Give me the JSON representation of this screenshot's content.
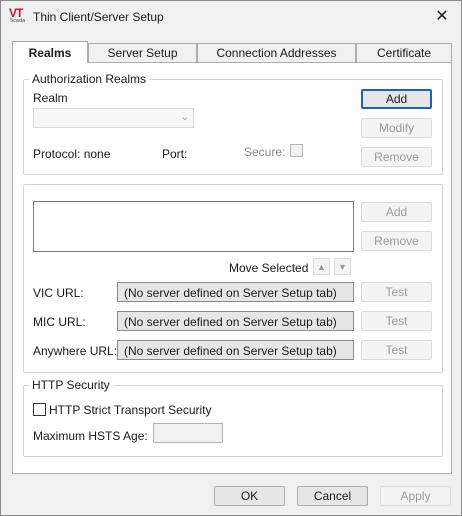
{
  "window": {
    "title": "Thin Client/Server Setup",
    "icon_text": "VT",
    "icon_subtext": "Scada",
    "close_glyph": "✕"
  },
  "tabs": [
    {
      "label": "Realms",
      "active": true
    },
    {
      "label": "Server Setup",
      "active": false
    },
    {
      "label": "Connection Addresses",
      "active": false
    },
    {
      "label": "Certificate",
      "active": false
    }
  ],
  "realms_group": {
    "title": "Authorization Realms",
    "realm_label": "Realm",
    "realm_value": "",
    "protocol_label": "Protocol: none",
    "port_label": "Port:",
    "secure_label": "Secure:",
    "add_label": "Add",
    "modify_label": "Modify",
    "remove_label": "Remove"
  },
  "urls_group": {
    "add_label": "Add",
    "remove_label": "Remove",
    "move_selected_label": "Move Selected",
    "up_glyph": "▲",
    "down_glyph": "▼",
    "rows": [
      {
        "label": "VIC URL:",
        "value": "(No server defined on Server Setup tab)",
        "test_label": "Test"
      },
      {
        "label": "MIC URL:",
        "value": "(No server defined on Server Setup tab)",
        "test_label": "Test"
      },
      {
        "label": "Anywhere URL:",
        "value": "(No server defined on Server Setup tab)",
        "test_label": "Test"
      }
    ]
  },
  "http_group": {
    "title": "HTTP Security",
    "hsts_label": "HTTP Strict Transport Security",
    "hsts_checked": false,
    "max_age_label": "Maximum HSTS Age:",
    "max_age_value": ""
  },
  "footer": {
    "ok_label": "OK",
    "cancel_label": "Cancel",
    "apply_label": "Apply"
  }
}
